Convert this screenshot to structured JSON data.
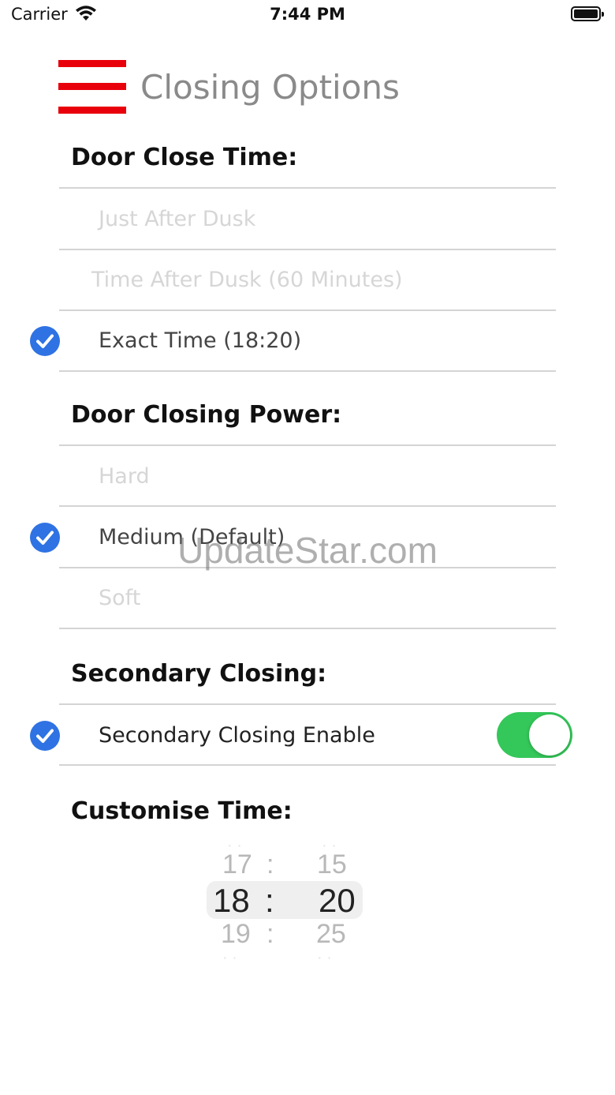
{
  "status_bar": {
    "carrier": "Carrier",
    "time": "7:44 PM"
  },
  "header": {
    "title": "Closing Options"
  },
  "sections": {
    "close_time": {
      "title": "Door Close Time:",
      "options": [
        "Just After Dusk",
        "Time After Dusk (60 Minutes)",
        "Exact Time (18:20)"
      ],
      "selected": "Exact Time (18:20)"
    },
    "closing_power": {
      "title": "Door Closing Power:",
      "options": [
        "Hard",
        "Medium (Default)",
        "Soft"
      ],
      "selected": "Medium (Default)"
    },
    "secondary": {
      "title": "Secondary Closing:",
      "enable_label": "Secondary Closing Enable",
      "enabled": true
    },
    "customise": {
      "title": "Customise Time:",
      "picker": {
        "hours": [
          "17",
          "18",
          "19"
        ],
        "minutes": [
          "15",
          "20",
          "25"
        ],
        "separator": ":",
        "selected_hour": "18",
        "selected_minute": "20"
      }
    }
  },
  "watermark": "UpdateStar.com",
  "colors": {
    "menu_red": "#e8000b",
    "check_blue": "#2f72e3",
    "toggle_green": "#34c759"
  }
}
